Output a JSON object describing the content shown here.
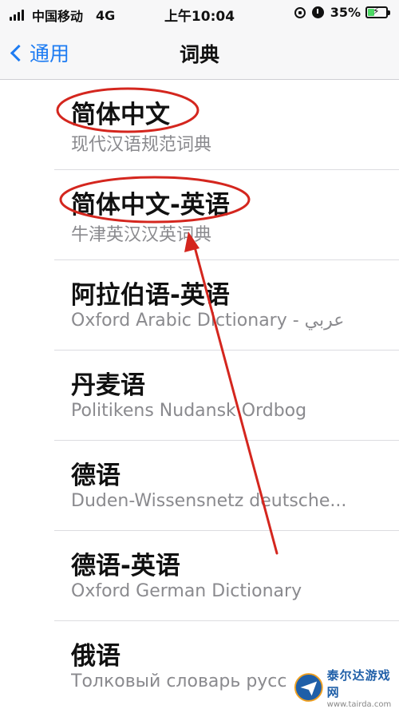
{
  "status_bar": {
    "carrier": "中国移动",
    "network": "4G",
    "time": "上午10:04",
    "battery_percent": "35%",
    "battery_level": 0.35,
    "lock_icon": "orientation-lock-icon",
    "alarm_icon": "alarm-icon"
  },
  "nav": {
    "back_label": "通用",
    "title": "词典"
  },
  "dictionaries": [
    {
      "title": "简体中文",
      "subtitle": "现代汉语规范词典",
      "highlighted": true
    },
    {
      "title": "简体中文-英语",
      "subtitle": "牛津英汉汉英词典",
      "highlighted": true
    },
    {
      "title": "阿拉伯语-英语",
      "subtitle": "Oxford Arabic Dictionary - عربي"
    },
    {
      "title": "丹麦语",
      "subtitle": "Politikens Nudansk Ordbog"
    },
    {
      "title": "德语",
      "subtitle": "Duden-Wissensnetz deutsche..."
    },
    {
      "title": "德语-英语",
      "subtitle": "Oxford German Dictionary"
    },
    {
      "title": "俄语",
      "subtitle": "Толковый словарь русс"
    }
  ],
  "annotation": {
    "color": "#d4261e"
  },
  "watermark": {
    "name": "泰尔达游戏网",
    "url": "www.tairda.com"
  },
  "colors": {
    "accent": "#1e7cf2",
    "subtitle": "#8a8a8e",
    "battery_fill": "#4cd964"
  }
}
